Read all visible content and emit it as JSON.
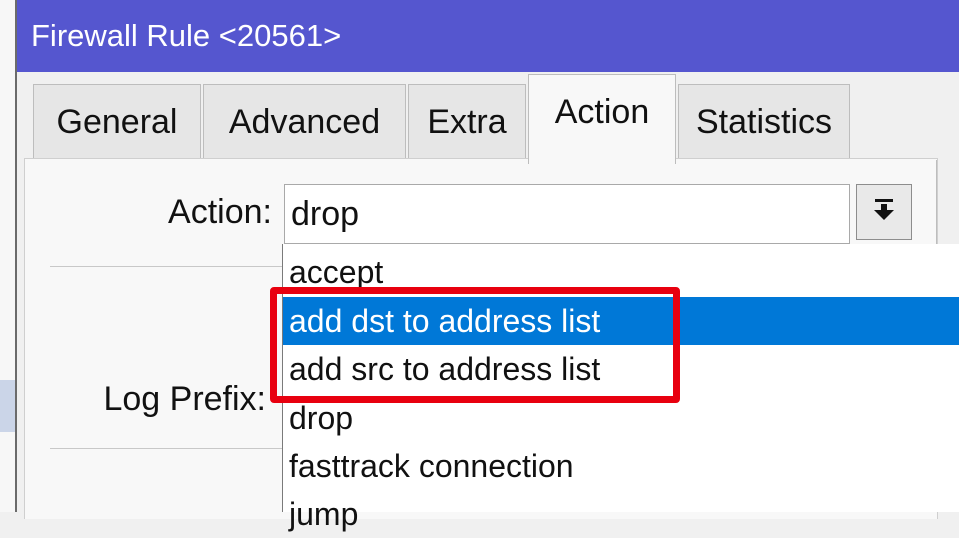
{
  "window": {
    "title": "Firewall Rule <20561>"
  },
  "tabs": [
    {
      "label": "General",
      "active": false
    },
    {
      "label": "Advanced",
      "active": false
    },
    {
      "label": "Extra",
      "active": false
    },
    {
      "label": "Action",
      "active": true
    },
    {
      "label": "Statistics",
      "active": false
    }
  ],
  "form": {
    "action_label": "Action:",
    "action_value": "drop",
    "log_prefix_label": "Log Prefix:"
  },
  "dropdown": {
    "options": [
      "accept",
      "add dst to address list",
      "add src to address list",
      "drop",
      "fasttrack connection",
      "jump"
    ],
    "highlighted": "add dst to address list"
  },
  "annotation": {
    "color": "#e8000f"
  },
  "colors": {
    "titlebar": "#5556cf",
    "highlight": "#0078d7"
  }
}
